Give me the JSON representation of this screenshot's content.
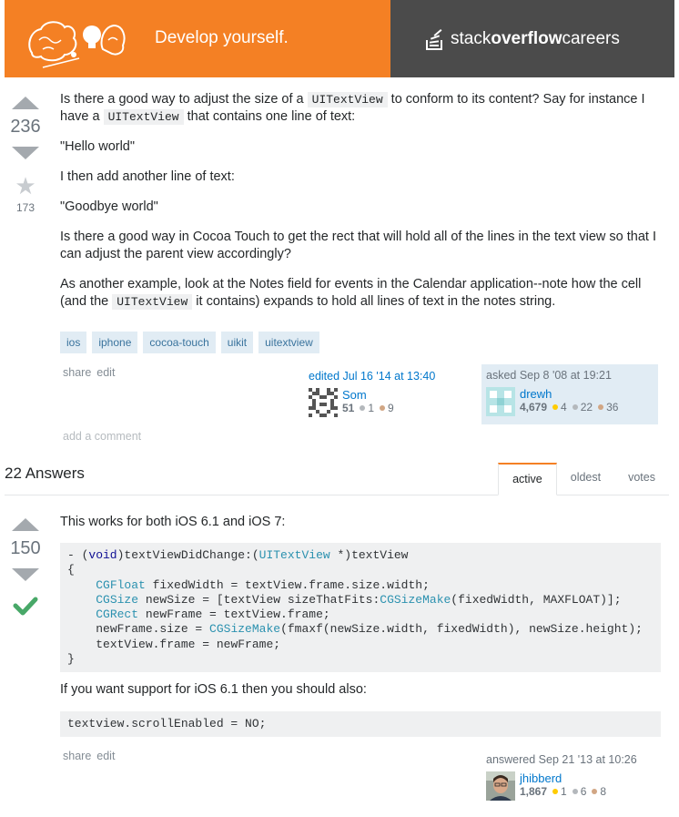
{
  "banner": {
    "tagline": "Develop yourself.",
    "logo_regular_1": "stack",
    "logo_bold": "overflow",
    "logo_regular_2": "careers",
    "left_color": "#f48024",
    "right_color": "#4b4b4b"
  },
  "question": {
    "score": "236",
    "favorites": "173",
    "p1_a": "Is there a good way to adjust the size of a ",
    "code1": "UITextView",
    "p1_b": " to conform to its content? Say for instance I have a ",
    "code2": "UITextView",
    "p1_c": " that contains one line of text:",
    "p2": "\"Hello world\"",
    "p3": "I then add another line of text:",
    "p4": "\"Goodbye world\"",
    "p5": "Is there a good way in Cocoa Touch to get the rect that will hold all of the lines in the text view so that I can adjust the parent view accordingly?",
    "p6_a": "As another example, look at the Notes field for events in the Calendar application--note how the cell (and the ",
    "code3": "UITextView",
    "p6_b": " it contains) expands to hold all lines of text in the notes string.",
    "tags": [
      "ios",
      "iphone",
      "cocoa-touch",
      "uikit",
      "uitextview"
    ],
    "menu": {
      "share": "share",
      "edit": "edit"
    },
    "edited": {
      "time": "edited Jul 16 '14 at 13:40",
      "user": "Som",
      "rep": "51",
      "silver": "1",
      "bronze": "9"
    },
    "asked": {
      "time": "asked Sep 8 '08 at 19:21",
      "user": "drewh",
      "rep": "4,679",
      "gold": "4",
      "silver": "22",
      "bronze": "36"
    },
    "add_comment": "add a comment"
  },
  "answers_header": {
    "count": "22 Answers",
    "tabs": [
      "active",
      "oldest",
      "votes"
    ]
  },
  "answer": {
    "score": "150",
    "intro": "This works for both iOS 6.1 and iOS 7:",
    "code_lines": {
      "l1a": "- (",
      "l1kw": "void",
      "l1b": ")textViewDidChange:(",
      "l1ty": "UITextView",
      "l1c": " *)textView",
      "l2": "{",
      "l3ty": "CGFloat",
      "l3": " fixedWidth = textView.frame.size.width;",
      "l4ty": "CGSize",
      "l4a": " newSize = [textView sizeThatFits:",
      "l4ty2": "CGSizeMake",
      "l4b": "(fixedWidth, MAXFLOAT)];",
      "l5ty": "CGRect",
      "l5": " newFrame = textView.frame;",
      "l6a": "newFrame.size = ",
      "l6ty": "CGSizeMake",
      "l6b": "(fmaxf(newSize.width, fixedWidth), newSize.height);",
      "l7": "textView.frame = newFrame;",
      "l8": "}"
    },
    "mid_text": "If you want support for iOS 6.1 then you should also:",
    "code2": "textview.scrollEnabled = NO;",
    "menu": {
      "share": "share",
      "edit": "edit"
    },
    "answered": {
      "time": "answered Sep 21 '13 at 10:26",
      "user": "jhibberd",
      "rep": "1,867",
      "gold": "1",
      "silver": "6",
      "bronze": "8"
    }
  }
}
